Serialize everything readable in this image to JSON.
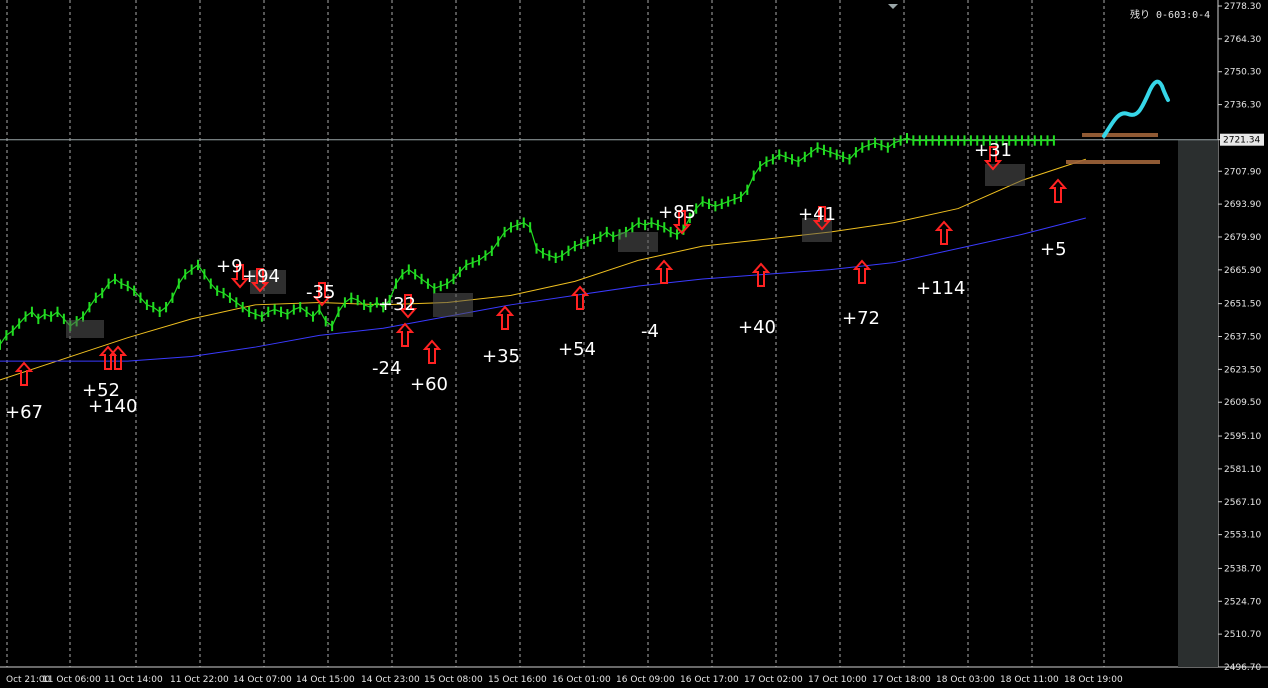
{
  "header": {
    "countdown": "残り 0-603:0-4"
  },
  "colors": {
    "background": "#000000",
    "candle": "#22dd22",
    "ma_fast": "#f0c020",
    "ma_slow": "#3a3aff",
    "arrow": "#ff2222",
    "grid": "#c8c8c8",
    "price_line": "#9aa6a8",
    "cyan_arrow": "#36d6e8",
    "level_lines": "#a0643a",
    "panel": "#2b2f2f"
  },
  "chart_data": {
    "type": "line",
    "title": "",
    "xlabel": "",
    "ylabel": "",
    "ylim": [
      2496.7,
      2778.3
    ],
    "current_price": "2721.34",
    "y_ticks": [
      "2778.30",
      "2764.30",
      "2750.30",
      "2736.30",
      "2721.34",
      "2707.90",
      "2693.90",
      "2679.90",
      "2665.90",
      "2651.50",
      "2637.50",
      "2623.50",
      "2609.50",
      "2595.10",
      "2581.10",
      "2567.10",
      "2553.10",
      "2538.70",
      "2524.70",
      "2510.70",
      "2496.70"
    ],
    "x_ticks": [
      "Oct 21:00",
      "11 Oct 06:00",
      "11 Oct 14:00",
      "11 Oct 22:00",
      "14 Oct 07:00",
      "14 Oct 15:00",
      "14 Oct 23:00",
      "15 Oct 08:00",
      "15 Oct 16:00",
      "16 Oct 01:00",
      "16 Oct 09:00",
      "16 Oct 17:00",
      "17 Oct 02:00",
      "17 Oct 10:00",
      "17 Oct 18:00",
      "18 Oct 03:00",
      "18 Oct 11:00",
      "18 Oct 19:00"
    ],
    "series": [
      {
        "kind": "price",
        "x": [
          0,
          2,
          4,
          6,
          8,
          10,
          12,
          14,
          16,
          18,
          20,
          22,
          24,
          26,
          28,
          30,
          32,
          34,
          36,
          38,
          40,
          42,
          44,
          46,
          48,
          50,
          52,
          54,
          56,
          58,
          60,
          62,
          64,
          66,
          68,
          70,
          72,
          74,
          76,
          78,
          80,
          82,
          84,
          86,
          88,
          90,
          92,
          94,
          96,
          98,
          100,
          102,
          104,
          106,
          108,
          110,
          112,
          114,
          116,
          118,
          120,
          122,
          124,
          126,
          128,
          130,
          132,
          134,
          136,
          138,
          140,
          142,
          144,
          146,
          148,
          150,
          152,
          154,
          156,
          158,
          160,
          162,
          164,
          166,
          168,
          170,
          172,
          174,
          176,
          178,
          180,
          182,
          184,
          186,
          188,
          190,
          192,
          194,
          196,
          198,
          200,
          202,
          204,
          206,
          208,
          210,
          212,
          214,
          216,
          218,
          220,
          222,
          224,
          226,
          228,
          230,
          232,
          234,
          236,
          238,
          240,
          242,
          244,
          246,
          248,
          250,
          252,
          254,
          256,
          258,
          260,
          262,
          264,
          266,
          268,
          270,
          272,
          274,
          276,
          278,
          280,
          282,
          284,
          286,
          288,
          290,
          292,
          294,
          296,
          298,
          300,
          302,
          304,
          306,
          308,
          310,
          312,
          314,
          316,
          318,
          320,
          322,
          324,
          326,
          328,
          330,
          332,
          334,
          336,
          338,
          340,
          342,
          344,
          346
        ],
        "values": [
          2634,
          2638,
          2640,
          2643,
          2646,
          2648,
          2645,
          2647,
          2646,
          2648,
          2645,
          2642,
          2644,
          2646,
          2650,
          2654,
          2656,
          2660,
          2662,
          2660,
          2659,
          2657,
          2654,
          2651,
          2650,
          2648,
          2650,
          2654,
          2660,
          2664,
          2666,
          2668,
          2664,
          2660,
          2657,
          2656,
          2654,
          2652,
          2650,
          2648,
          2647,
          2646,
          2648,
          2649,
          2648,
          2647,
          2649,
          2650,
          2648,
          2646,
          2649,
          2644,
          2642,
          2648,
          2652,
          2654,
          2653,
          2651,
          2650,
          2652,
          2650,
          2653,
          2660,
          2664,
          2666,
          2664,
          2662,
          2660,
          2658,
          2659,
          2660,
          2662,
          2665,
          2668,
          2669,
          2670,
          2672,
          2674,
          2678,
          2682,
          2684,
          2685,
          2686,
          2684,
          2675,
          2673,
          2672,
          2671,
          2672,
          2674,
          2676,
          2677,
          2678,
          2679,
          2680,
          2682,
          2680,
          2681,
          2682,
          2684,
          2686,
          2685,
          2686,
          2685,
          2684,
          2682,
          2681,
          2683,
          2688,
          2692,
          2695,
          2694,
          2693,
          2694,
          2695,
          2696,
          2697,
          2700,
          2706,
          2710,
          2712,
          2713,
          2715,
          2714,
          2713,
          2712,
          2714,
          2716,
          2718,
          2717,
          2716,
          2715,
          2714,
          2713,
          2716,
          2718,
          2719,
          2720,
          2719,
          2718,
          2720,
          2721,
          2722,
          2721,
          2721,
          2721,
          2721,
          2721,
          2721,
          2721,
          2721,
          2721,
          2721,
          2721,
          2721,
          2721,
          2721,
          2721,
          2721,
          2721,
          2721,
          2721,
          2721,
          2721,
          2721,
          2721,
          2721,
          2721,
          2721,
          2721,
          2721,
          2721,
          2721,
          2721
        ]
      },
      {
        "kind": "ma_fast",
        "x": [
          0,
          20,
          40,
          60,
          80,
          100,
          120,
          140,
          160,
          180,
          200,
          220,
          240,
          260,
          280,
          300,
          320,
          340
        ],
        "values": [
          2619,
          2628,
          2637,
          2645,
          2651,
          2652,
          2651,
          2652,
          2655,
          2661,
          2670,
          2676,
          2679,
          2682,
          2686,
          2692,
          2704,
          2713
        ]
      },
      {
        "kind": "ma_slow",
        "x": [
          0,
          20,
          40,
          60,
          80,
          100,
          120,
          140,
          160,
          180,
          200,
          220,
          240,
          260,
          280,
          300,
          320,
          340
        ],
        "values": [
          2627,
          2627,
          2627,
          2629,
          2633,
          2638,
          2641,
          2646,
          2651,
          2655,
          2659,
          2662,
          2664,
          2666,
          2669,
          2675,
          2681,
          2688
        ]
      }
    ],
    "annotations": [
      {
        "text": "+67",
        "dir": "up"
      },
      {
        "text": "+52",
        "dir": "up"
      },
      {
        "text": "+140",
        "dir": "up"
      },
      {
        "text": "+9",
        "dir": "down"
      },
      {
        "text": "+94",
        "dir": "down"
      },
      {
        "text": "-35",
        "dir": "down"
      },
      {
        "text": "+32",
        "dir": "down"
      },
      {
        "text": "-24",
        "dir": "up"
      },
      {
        "text": "+60",
        "dir": "up"
      },
      {
        "text": "+35",
        "dir": "up"
      },
      {
        "text": "+54",
        "dir": "up"
      },
      {
        "text": "+85",
        "dir": "down"
      },
      {
        "text": "-4",
        "dir": "up"
      },
      {
        "text": "+40",
        "dir": "up"
      },
      {
        "text": "+41",
        "dir": "down"
      },
      {
        "text": "+72",
        "dir": "up"
      },
      {
        "text": "+114",
        "dir": "up"
      },
      {
        "text": "+31",
        "dir": "down"
      },
      {
        "text": "+5",
        "dir": "up"
      }
    ]
  }
}
